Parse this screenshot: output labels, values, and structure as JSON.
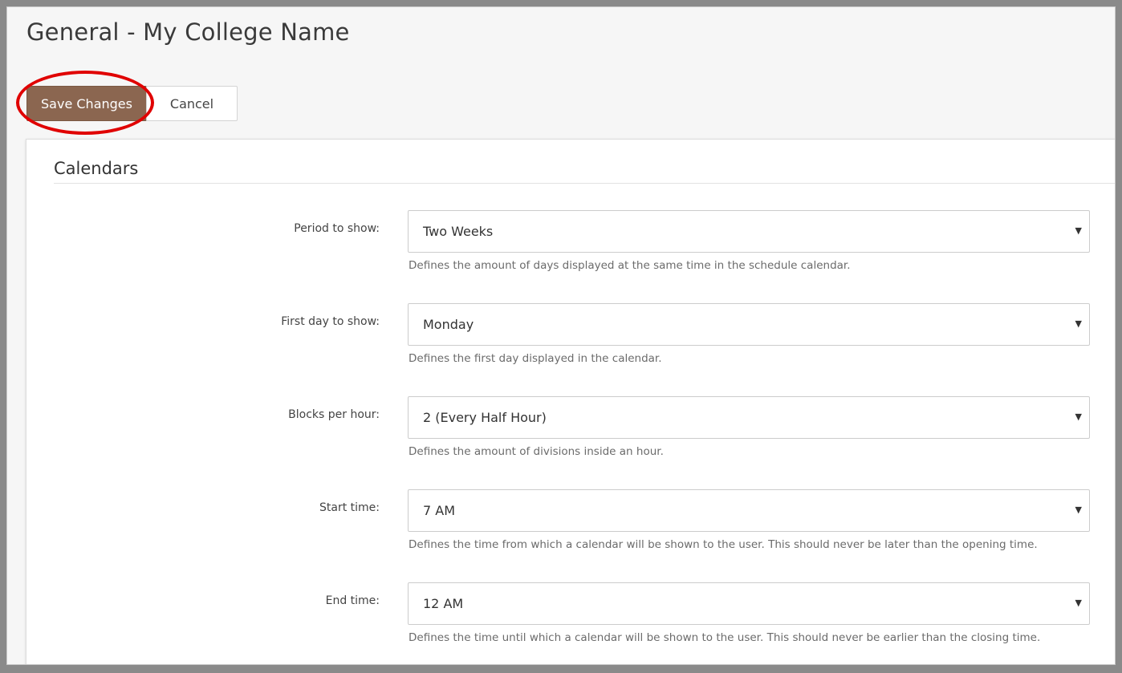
{
  "page": {
    "title": "General - My College Name"
  },
  "toolbar": {
    "save_label": "Save Changes",
    "cancel_label": "Cancel"
  },
  "colors": {
    "save_button_bg": "#8b6650",
    "highlight_ring": "#e00000"
  },
  "section": {
    "title": "Calendars"
  },
  "fields": [
    {
      "label": "Period to show:",
      "value": "Two Weeks",
      "help": "Defines the amount of days displayed at the same time in the schedule calendar."
    },
    {
      "label": "First day to show:",
      "value": "Monday",
      "help": "Defines the first day displayed in the calendar."
    },
    {
      "label": "Blocks per hour:",
      "value": "2 (Every Half Hour)",
      "help": "Defines the amount of divisions inside an hour."
    },
    {
      "label": "Start time:",
      "value": "7 AM",
      "help": "Defines the time from which a calendar will be shown to the user. This should never be later than the opening time."
    },
    {
      "label": "End time:",
      "value": "12 AM",
      "help": "Defines the time until which a calendar will be shown to the user. This should never be earlier than the closing time."
    }
  ],
  "icons": {
    "dropdown": "chevron-down-icon"
  }
}
